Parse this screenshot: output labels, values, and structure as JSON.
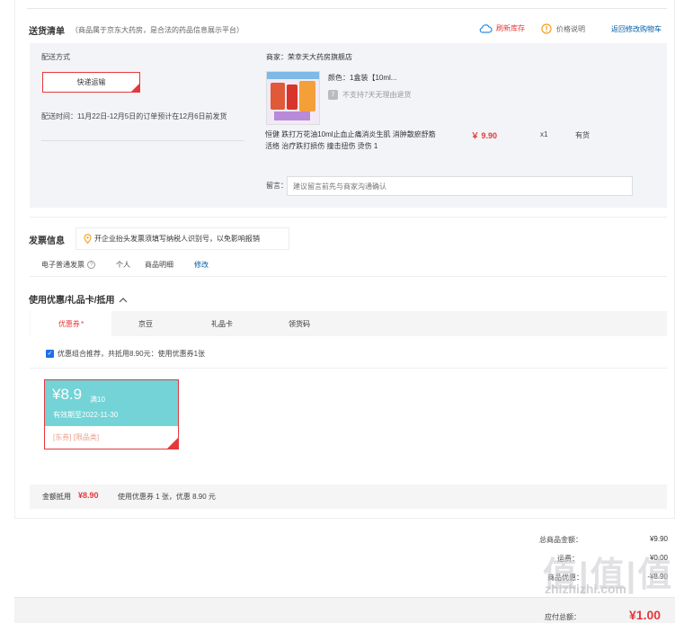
{
  "shipping": {
    "title": "送货清单",
    "note": "（商品属于京东大药房，是合法的药品信息展示平台）",
    "refresh_label": "刷新库存",
    "price_note_label": "价格说明",
    "back_cart_label": "返回修改购物车",
    "method_label": "配送方式",
    "method_value": "快递运输",
    "time_text": "配送时间：11月22日-12月5日的订单预计在12月6日前发货"
  },
  "product": {
    "store": "商家：荣幸天大药房旗舰店",
    "color": "颜色：1盒装【10ml...",
    "no_return": "不支持7天无理由退货",
    "name": "恒健 跌打万花油10ml止血止痛消炎生肌 消肿散瘀舒筋活络 治疗跌打损伤 撞击扭伤 烫伤 1",
    "price": "￥ 9.90",
    "qty": "x1",
    "stock": "有货",
    "message_label": "留言：",
    "message_placeholder": "建议留言前先与商家沟通确认"
  },
  "invoice": {
    "title": "发票信息",
    "tip": "开企业抬头发票须填写纳税人识别号，以免影响报销",
    "type": "电子普通发票",
    "person": "个人",
    "detail": "商品明细",
    "edit": "修改"
  },
  "coupon": {
    "title": "使用优惠/礼品卡/抵用",
    "tabs": [
      "优惠券",
      "京豆",
      "礼品卡",
      "领货码"
    ],
    "tab_mark": "*",
    "combo_text": "优惠组合推荐，共抵用8.90元：使用优惠券1张",
    "card_amount": "¥8.9",
    "card_condition": "满10",
    "card_expiry": "有效期至2022-11-30",
    "card_tags": "[东券] [限品类]",
    "sum_label": "金额抵用",
    "sum_amount": "¥8.90",
    "sum_desc": "使用优惠券 1 张，优惠 8.90 元"
  },
  "totals": {
    "goods_label": "总商品金额：",
    "goods_value": "¥9.90",
    "row2_label": "运费：",
    "row2_value": "¥0.00",
    "row3_label": "商品优惠：",
    "row3_value": "-¥8.90",
    "pay_label": "应付总额：",
    "pay_value": "¥1.00"
  },
  "watermark": {
    "big": "值|值|值",
    "small": "zhizhizhi.com"
  },
  "colors": {
    "accent": "#e4393c",
    "link": "#005ea7",
    "coupon_teal": "#73d3d6"
  }
}
